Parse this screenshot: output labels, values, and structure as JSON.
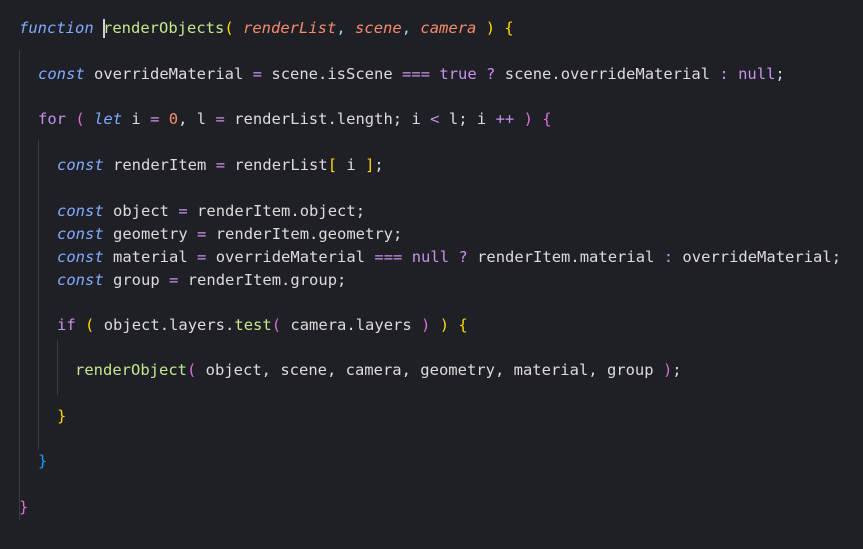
{
  "code": {
    "line1": {
      "kw": "function",
      "fn": "renderObjects",
      "open": "(",
      "p1": "renderList",
      "c1": ",",
      "p2": "scene",
      "c2": ",",
      "p3": "camera",
      "close": ")",
      "brace": "{"
    },
    "line2": {
      "kw": "const",
      "name": "overrideMaterial",
      "eq": "=",
      "obj": "scene.isScene",
      "op": "===",
      "lit": "true",
      "q": "?",
      "val": "scene.overrideMaterial",
      "colon": ":",
      "nul": "null",
      "semi": ";"
    },
    "line3": {
      "kw": "for",
      "open": "(",
      "let": "let",
      "i": "i",
      "eq": "=",
      "zero": "0",
      "comma": ",",
      "l": "l",
      "eq2": "=",
      "len": "renderList.length",
      "semi1": ";",
      "i2": "i",
      "lt": "<",
      "l2": "l",
      "semi2": ";",
      "i3": "i",
      "inc": "++",
      "close": ")",
      "brace": "{"
    },
    "line4": {
      "kw": "const",
      "name": "renderItem",
      "eq": "=",
      "arr": "renderList",
      "bo": "[",
      "idx": "i",
      "bc": "]",
      "semi": ";"
    },
    "line5": {
      "kw": "const",
      "name": "object",
      "eq": "=",
      "val": "renderItem.object",
      "semi": ";"
    },
    "line6": {
      "kw": "const",
      "name": "geometry",
      "eq": "=",
      "val": "renderItem.geometry",
      "semi": ";"
    },
    "line7": {
      "kw": "const",
      "name": "material",
      "eq": "=",
      "cond": "overrideMaterial",
      "op": "===",
      "nul": "null",
      "q": "?",
      "val": "renderItem.material",
      "colon": ":",
      "alt": "overrideMaterial",
      "semi": ";"
    },
    "line8": {
      "kw": "const",
      "name": "group",
      "eq": "=",
      "val": "renderItem.group",
      "semi": ";"
    },
    "line9": {
      "kw": "if",
      "open": "(",
      "obj": "object.layers.",
      "method": "test",
      "mopen": "(",
      "arg": "camera.layers",
      "mclose": ")",
      "close": ")",
      "brace": "{"
    },
    "line10": {
      "fn": "renderObject",
      "open": "(",
      "args": "object, scene, camera, geometry, material, group",
      "close": ")",
      "semi": ";"
    },
    "line11": {
      "brace": "}"
    },
    "line12": {
      "brace": "}"
    },
    "line13": {
      "brace": "}"
    }
  }
}
